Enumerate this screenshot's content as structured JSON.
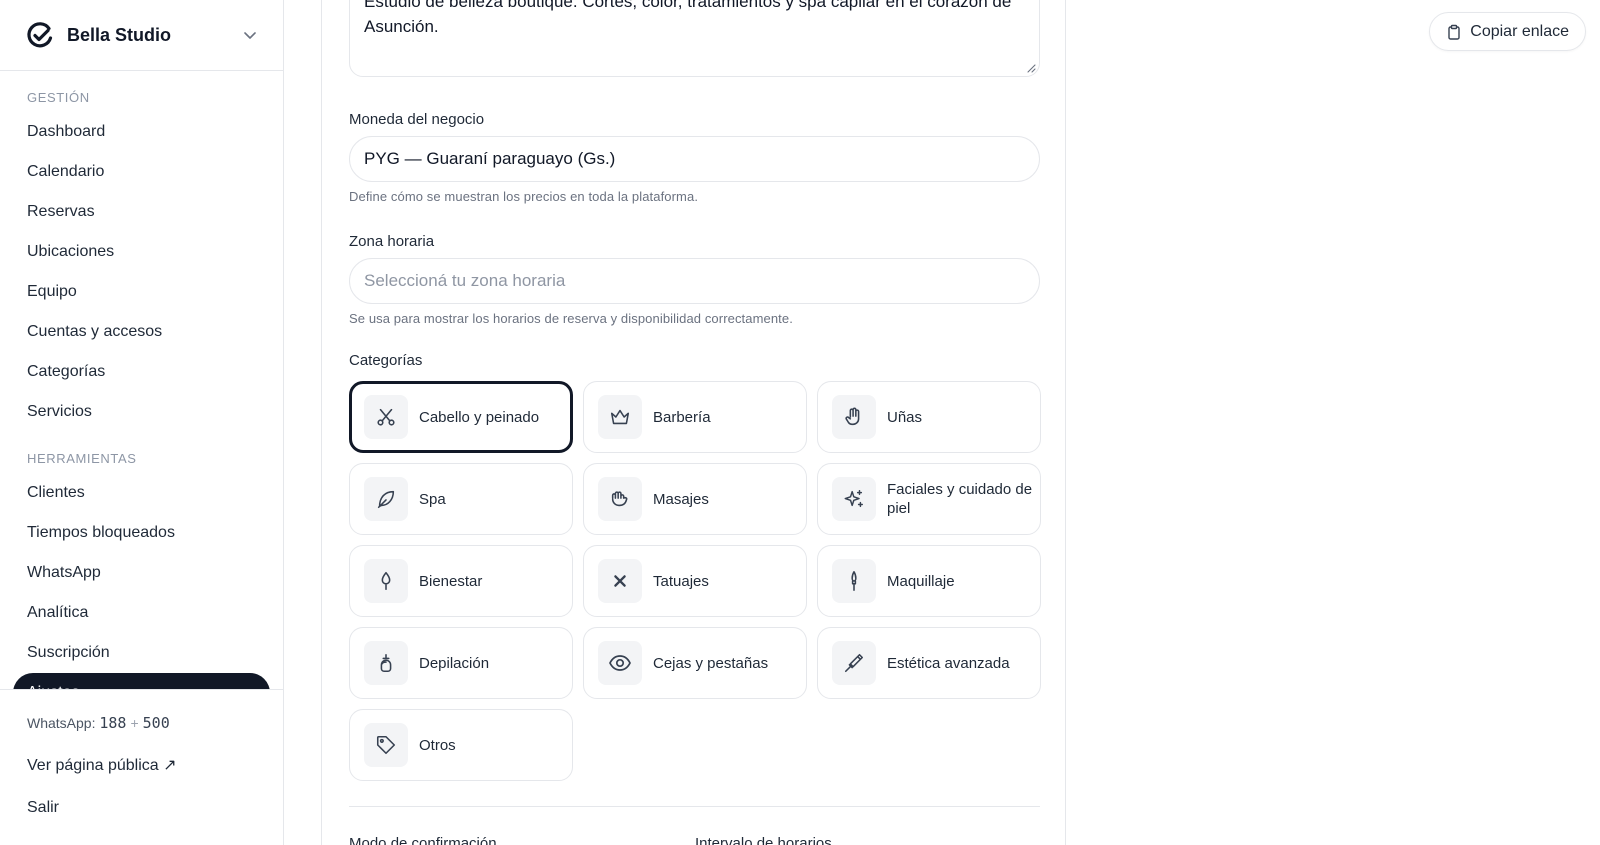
{
  "brand": {
    "name": "Bella Studio"
  },
  "nav": {
    "section_management": "GESTIÓN",
    "management_items": [
      "Dashboard",
      "Calendario",
      "Reservas",
      "Ubicaciones",
      "Equipo",
      "Cuentas y accesos",
      "Categorías",
      "Servicios"
    ],
    "section_tools": "HERRAMIENTAS",
    "tools_items": [
      "Clientes",
      "Tiempos bloqueados",
      "WhatsApp",
      "Analítica",
      "Suscripción",
      "Ajustes"
    ]
  },
  "footer": {
    "whatsapp_label": "WhatsApp:",
    "whatsapp_used": "188",
    "whatsapp_plus": "+",
    "whatsapp_extra": "500",
    "public_page": "Ver página pública ↗",
    "logout": "Salir"
  },
  "header": {
    "copy_link": "Copiar enlace"
  },
  "form": {
    "description_value": "Estudio de belleza boutique. Cortes, color, tratamientos y spa capilar en el corazón de Asunción.",
    "currency_label": "Moneda del negocio",
    "currency_value": "PYG — Guaraní paraguayo (Gs.)",
    "currency_help": "Define cómo se muestran los precios en toda la plataforma.",
    "timezone_label": "Zona horaria",
    "timezone_placeholder": "Seleccioná tu zona horaria",
    "timezone_help": "Se usa para mostrar los horarios de reserva y disponibilidad correctamente.",
    "categories_label": "Categorías",
    "categories": [
      {
        "label": "Cabello y peinado",
        "icon": "scissors-icon",
        "selected": true
      },
      {
        "label": "Barbería",
        "icon": "crown-icon",
        "selected": false
      },
      {
        "label": "Uñas",
        "icon": "hand-icon",
        "selected": false
      },
      {
        "label": "Spa",
        "icon": "leaf-icon",
        "selected": false
      },
      {
        "label": "Masajes",
        "icon": "massage-hand-icon",
        "selected": false
      },
      {
        "label": "Faciales y cuidado de piel",
        "icon": "sparkles-icon",
        "selected": false
      },
      {
        "label": "Bienestar",
        "icon": "lotus-icon",
        "selected": false
      },
      {
        "label": "Tatuajes",
        "icon": "x-cross-icon",
        "selected": false
      },
      {
        "label": "Maquillaje",
        "icon": "brush-icon",
        "selected": false
      },
      {
        "label": "Depilación",
        "icon": "wax-icon",
        "selected": false
      },
      {
        "label": "Cejas y pestañas",
        "icon": "eye-icon",
        "selected": false
      },
      {
        "label": "Estética avanzada",
        "icon": "syringe-icon",
        "selected": false
      },
      {
        "label": "Otros",
        "icon": "tag-icon",
        "selected": false
      }
    ],
    "confirmation_mode_label": "Modo de confirmación",
    "slot_interval_label": "Intervalo de horarios"
  },
  "colors": {
    "accent": "#111827",
    "border": "#e5e7eb",
    "muted": "#6b7280"
  }
}
